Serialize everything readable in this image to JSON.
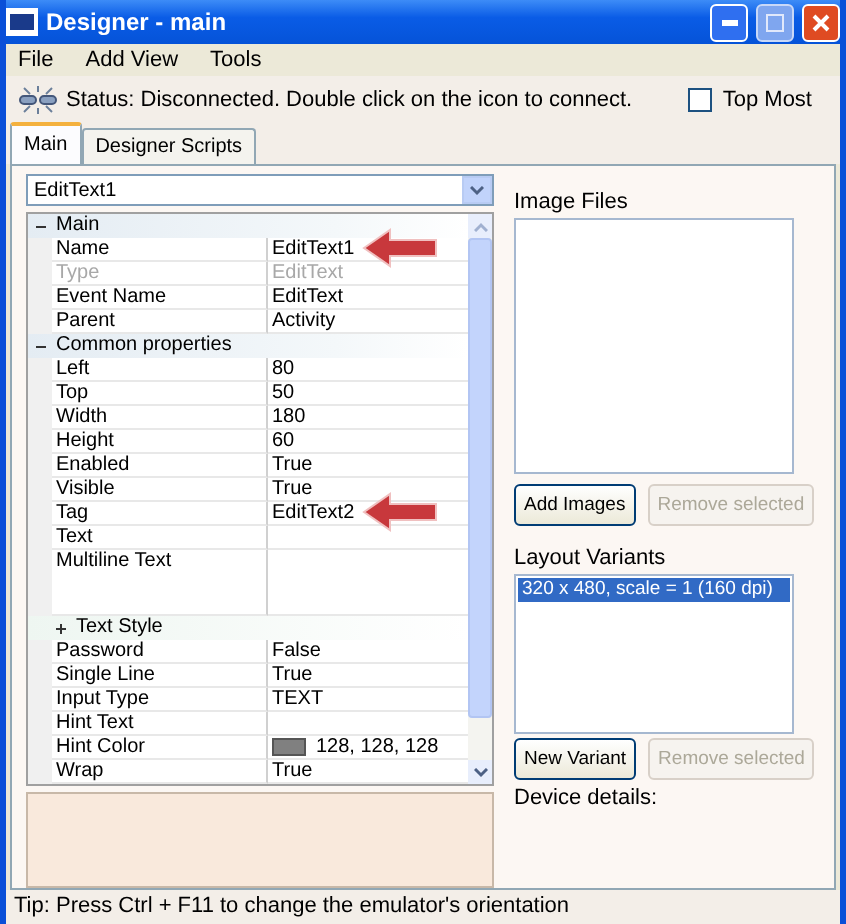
{
  "window": {
    "title": "Designer - main"
  },
  "menu": [
    {
      "label": "File"
    },
    {
      "label": "Add View"
    },
    {
      "label": "Tools"
    }
  ],
  "status": {
    "text": "Status: Disconnected. Double click on the icon to connect."
  },
  "top_most": {
    "label": "Top Most",
    "checked": false
  },
  "tabs": [
    {
      "label": "Main",
      "selected": true
    },
    {
      "label": "Designer Scripts",
      "selected": false
    }
  ],
  "view_selector": {
    "value": "EditText1"
  },
  "properties": [
    {
      "kind": "category",
      "name": "Main",
      "expanded": true,
      "children": [
        {
          "kind": "single",
          "name": "Name",
          "value": "EditText1",
          "disabled": false,
          "annotated": true
        },
        {
          "kind": "single",
          "name": "Type",
          "value": "EditText",
          "disabled": true,
          "annotated": false
        },
        {
          "kind": "single",
          "name": "Event Name",
          "value": "EditText",
          "disabled": false,
          "annotated": false
        },
        {
          "kind": "single",
          "name": "Parent",
          "value": "Activity",
          "disabled": false,
          "annotated": false
        }
      ]
    },
    {
      "kind": "category",
      "name": "Common properties",
      "expanded": true,
      "children": [
        {
          "kind": "single",
          "name": "Left",
          "value": "80",
          "disabled": false,
          "annotated": false
        },
        {
          "kind": "single",
          "name": "Top",
          "value": "50",
          "disabled": false,
          "annotated": false
        },
        {
          "kind": "single",
          "name": "Width",
          "value": "180",
          "disabled": false,
          "annotated": false
        },
        {
          "kind": "single",
          "name": "Height",
          "value": "60",
          "disabled": false,
          "annotated": false
        },
        {
          "kind": "single",
          "name": "Enabled",
          "value": "True",
          "disabled": false,
          "annotated": false
        },
        {
          "kind": "single",
          "name": "Visible",
          "value": "True",
          "disabled": false,
          "annotated": false
        },
        {
          "kind": "single",
          "name": "Tag",
          "value": "EditText2",
          "disabled": false,
          "annotated": true
        },
        {
          "kind": "single",
          "name": "Text",
          "disabled": false,
          "annotated": false
        },
        {
          "kind": "multiline",
          "name": "Multiline Text",
          "disabled": false,
          "annotated": false
        }
      ]
    },
    {
      "kind": "category",
      "name": "Text Style",
      "expanded": false,
      "children": [
        {
          "kind": "single",
          "name": "Password",
          "value": "False",
          "disabled": false,
          "annotated": false
        },
        {
          "kind": "single",
          "name": "Single Line",
          "value": "True",
          "disabled": false,
          "annotated": false
        },
        {
          "kind": "single",
          "name": "Input Type",
          "value": "TEXT",
          "disabled": false,
          "annotated": false
        },
        {
          "kind": "single",
          "name": "Hint Text",
          "disabled": false,
          "annotated": false
        },
        {
          "kind": "single",
          "name": "Hint Color",
          "value": "128, 128, 128",
          "color": "#808080",
          "disabled": false,
          "annotated": false
        },
        {
          "kind": "single",
          "name": "Wrap",
          "value": "True",
          "disabled": false,
          "annotated": false
        }
      ]
    }
  ],
  "image_files": {
    "label": "Image Files",
    "buttons": [
      {
        "label": "Add Images",
        "disabled": false
      },
      {
        "label": "Remove selected",
        "disabled": true
      }
    ]
  },
  "layout_variants": {
    "label": "Layout Variants",
    "items": [
      {
        "label": "320 x 480, scale = 1 (160 dpi)",
        "selected": true
      }
    ],
    "buttons": [
      {
        "label": "New Variant",
        "disabled": false
      },
      {
        "label": "Remove selected",
        "disabled": true
      }
    ]
  },
  "device_details": {
    "label": "Device details:"
  },
  "tip": "Tip: Press Ctrl + F11 to change the emulator's orientation"
}
